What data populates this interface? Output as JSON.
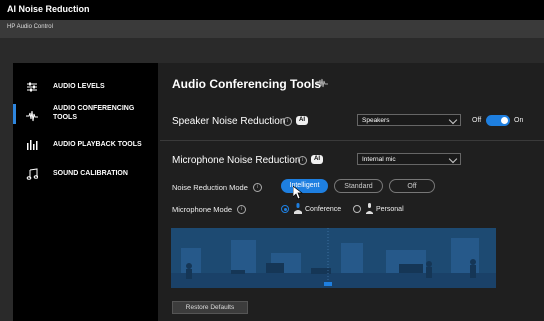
{
  "app_title": "AI Noise Reduction",
  "menu_title": "HP Audio Control",
  "sidebar": {
    "items": [
      {
        "label_line1": "AUDIO LEVELS",
        "label_line2": "",
        "icon": "sliders-icon"
      },
      {
        "label_line1": "AUDIO CONFERENCING",
        "label_line2": "TOOLS",
        "icon": "waveform-icon"
      },
      {
        "label_line1": "AUDIO PLAYBACK TOOLS",
        "label_line2": "",
        "icon": "equalizer-icon"
      },
      {
        "label_line1": "SOUND CALIBRATION",
        "label_line2": "",
        "icon": "music-note-icon"
      }
    ]
  },
  "main": {
    "title": "Audio Conferencing Tools",
    "speaker": {
      "label": "Speaker Noise Reduction",
      "badge": "AI",
      "device": "Speakers",
      "off_label": "Off",
      "on_label": "On",
      "toggle_on": true
    },
    "microphone": {
      "label": "Microphone Noise Reduction",
      "badge": "AI",
      "device": "Internal mic"
    },
    "mode": {
      "label": "Noise Reduction Mode",
      "options": [
        "Intelligent",
        "Standard",
        "Off"
      ],
      "selected": "Intelligent"
    },
    "mic_mode": {
      "label": "Microphone Mode",
      "options": [
        "Conference",
        "Personal"
      ],
      "selected": "Conference"
    },
    "restore_label": "Restore Defaults"
  },
  "colors": {
    "accent": "#1e7fe0",
    "scene": "#1d4a72"
  }
}
